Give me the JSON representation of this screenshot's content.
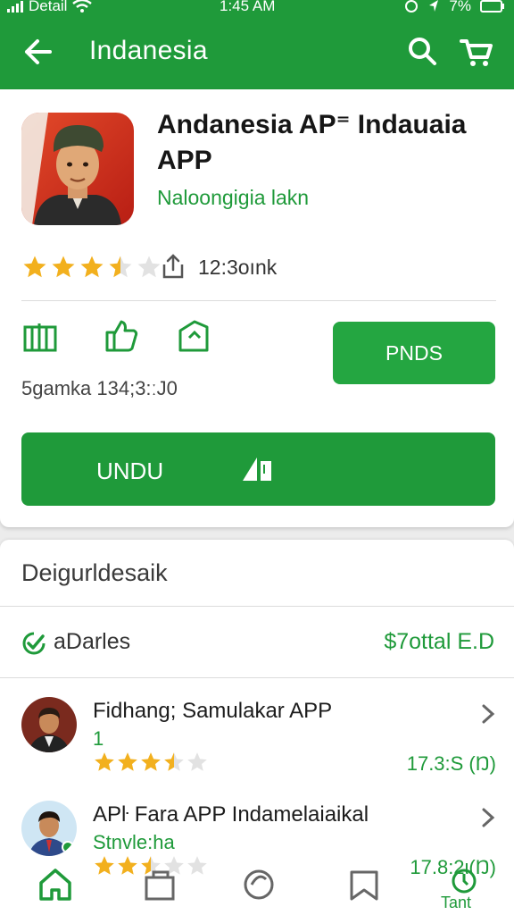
{
  "status": {
    "carrier": "Detail",
    "time": "1:45 AM",
    "battery": "7%"
  },
  "header": {
    "title": "Indanesia"
  },
  "app": {
    "name": "Andanesia AP⁼ Indauaia APP",
    "developer": "Naloongigia lakn",
    "rating_value": 3.5,
    "downloads": "12:3oınk",
    "size_text": "5gamka 134;3:ːJ0",
    "secondary_button": "PNDS",
    "primary_button": "UNDU"
  },
  "section": {
    "title": "Deigurldesaik",
    "badge_label": "aDarles",
    "total_label": "$7ottal E.D"
  },
  "list": [
    {
      "title": "Fidhang; Samulakar APP",
      "subtitle": "1",
      "rating_value": 3.5,
      "meta": "17.3:S (Ŋ)"
    },
    {
      "title": "APŀ Fara APP Indamelaiaikal",
      "subtitle": "Stnvle:ha",
      "rating_value": 2.5,
      "meta": "17.8:2ι(Ŋ)"
    }
  ],
  "nav": {
    "last_label": "Tant"
  },
  "colors": {
    "primary": "#1f9a3a",
    "star": "#f2b01e",
    "background": "#ececec"
  }
}
